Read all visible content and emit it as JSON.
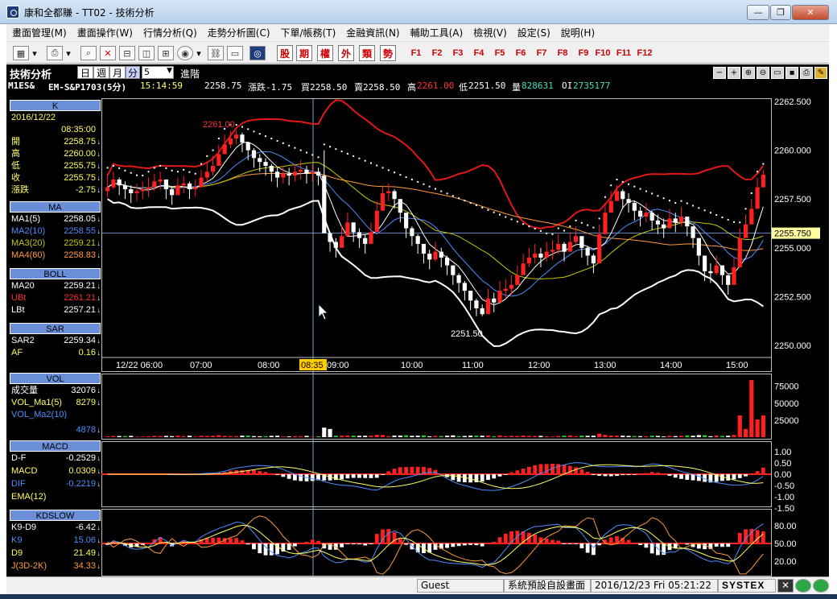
{
  "window": {
    "title": "康和全都賺 - TT02 - 技術分析",
    "btn_min": "—",
    "btn_max": "❐",
    "btn_close": "✕"
  },
  "menu": [
    "畫面管理(M)",
    "畫面操作(W)",
    "行情分析(Q)",
    "走勢分析圖(C)",
    "下單/帳務(T)",
    "金融資訊(N)",
    "輔助工具(A)",
    "檢視(V)",
    "設定(S)",
    "說明(H)"
  ],
  "toolbar": {
    "red_buttons": [
      "股",
      "期",
      "權",
      "外",
      "類",
      "勢"
    ],
    "function_keys": [
      "F1",
      "F2",
      "F3",
      "F4",
      "F5",
      "F6",
      "F7",
      "F8",
      "F9",
      "F10",
      "F11",
      "F12"
    ]
  },
  "analysis": {
    "title": "技術分析",
    "periods": [
      "日",
      "週",
      "月",
      "分"
    ],
    "period_value": "5",
    "advanced": "進階"
  },
  "quote": {
    "symbol": "M1ES&",
    "name": "EM-S&P1703(5分)",
    "time": "15:14:59",
    "last": "2258.75",
    "change": "漲跌-1.75",
    "bid": "買2258.50",
    "ask": "賣2258.50",
    "high_label": "高",
    "high": "2261.00",
    "low_label": "低",
    "low": "2251.50",
    "vol_label": "量",
    "vol": "828631",
    "oi_label": "OI",
    "oi": "2735177"
  },
  "left_panel": {
    "k_header": "K",
    "date": "2016/12/22",
    "time": "08:35:00",
    "ohlc": [
      {
        "k": "開",
        "v": "2258.75"
      },
      {
        "k": "高",
        "v": "2260.00"
      },
      {
        "k": "低",
        "v": "2255.75"
      },
      {
        "k": "收",
        "v": "2255.75"
      },
      {
        "k": "漲跌",
        "v": "-2.75"
      }
    ],
    "ma_header": "MA",
    "ma": [
      {
        "k": "MA1(5)",
        "v": "2258.05",
        "c": "#ffffff"
      },
      {
        "k": "MA2(10)",
        "v": "2258.55",
        "c": "#4f8cff"
      },
      {
        "k": "MA3(20)",
        "v": "2259.21",
        "c": "#c8c800"
      },
      {
        "k": "MA4(60)",
        "v": "2258.83",
        "c": "#ff9a3c"
      }
    ],
    "boll_header": "BOLL",
    "boll": [
      {
        "k": "MA20",
        "v": "2259.21",
        "c": "#ffffff"
      },
      {
        "k": "UBt",
        "v": "2261.21",
        "c": "#ff3030"
      },
      {
        "k": "LBt",
        "v": "2257.21",
        "c": "#ffffff"
      }
    ],
    "sar_header": "SAR",
    "sar": [
      {
        "k": "SAR2",
        "v": "2259.34",
        "c": "#ffffff"
      },
      {
        "k": "AF",
        "v": "0.16",
        "c": "#ffff60"
      }
    ],
    "vol_header": "VOL",
    "vol": [
      {
        "k": "成交量",
        "v": "32076",
        "c": "#ffffff"
      },
      {
        "k": "VOL_Ma1(5)",
        "v": "8279",
        "c": "#ffff60"
      },
      {
        "k": "VOL_Ma2(10)",
        "v": "",
        "c": "#4f8cff"
      },
      {
        "k": "",
        "v": "4878",
        "c": "#4f8cff"
      }
    ],
    "macd_header": "MACD",
    "macd": [
      {
        "k": "D-F",
        "v": "-0.2529",
        "c": "#ffffff"
      },
      {
        "k": "MACD",
        "v": "0.0309",
        "c": "#ffff60"
      },
      {
        "k": "DIF",
        "v": "-0.2219",
        "c": "#4f8cff"
      },
      {
        "k": "EMA(12)",
        "v": "",
        "c": "#ffff60"
      }
    ],
    "kd_header": "KDSLOW",
    "kd": [
      {
        "k": "K9-D9",
        "v": "-6.42",
        "c": "#ffffff"
      },
      {
        "k": "K9",
        "v": "15.06",
        "c": "#4f8cff"
      },
      {
        "k": "D9",
        "v": "21.49",
        "c": "#ffff60"
      },
      {
        "k": "J(3D-2K)",
        "v": "34.33",
        "c": "#ff9a3c"
      }
    ]
  },
  "chart_data": {
    "type": "candlestick",
    "price_axis": {
      "ticks": [
        "2262.500",
        "2260.000",
        "2257.500",
        "2255.000",
        "2252.500",
        "2250.000"
      ],
      "current": "2255.750"
    },
    "time_axis": {
      "labels": [
        "12/22 06:00",
        "07:00",
        "08:00",
        "09:00",
        "10:00",
        "11:00",
        "12:00",
        "13:00",
        "14:00",
        "15:00"
      ],
      "cursor": "08:35"
    },
    "annotations": {
      "high": "2261.00",
      "low": "2251.50"
    },
    "vol_axis": [
      "75000",
      "50000",
      "25000"
    ],
    "macd_axis": [
      "1.00",
      "0.50",
      "0.00",
      "-0.50",
      "-1.00",
      "-1.50"
    ],
    "kd_axis": [
      "80.00",
      "50.00",
      "20.00"
    ],
    "close": [
      2258.1,
      2258.5,
      2258.2,
      2258.0,
      2257.8,
      2257.9,
      2258.0,
      2258.1,
      2258.4,
      2258.5,
      2258.0,
      2257.7,
      2258.2,
      2258.3,
      2258.0,
      2258.1,
      2258.6,
      2258.9,
      2259.2,
      2259.8,
      2260.3,
      2260.6,
      2260.8,
      2260.4,
      2260.0,
      2259.6,
      2259.4,
      2259.2,
      2258.9,
      2258.6,
      2258.8,
      2258.7,
      2258.9,
      2259.0,
      2258.8,
      2258.9,
      2258.7,
      2255.75,
      2255.3,
      2255.0,
      2255.6,
      2256.3,
      2255.8,
      2255.5,
      2255.2,
      2255.8,
      2256.9,
      2257.8,
      2257.9,
      2257.5,
      2256.8,
      2256.0,
      2255.6,
      2255.2,
      2254.7,
      2254.4,
      2254.8,
      2254.5,
      2254.1,
      2253.6,
      2253.2,
      2252.8,
      2252.3,
      2251.9,
      2251.6,
      2252.4,
      2252.2,
      2252.8,
      2252.9,
      2253.1,
      2253.6,
      2254.2,
      2254.5,
      2254.7,
      2254.5,
      2254.8,
      2254.9,
      2255.2,
      2254.8,
      2255.3,
      2255.6,
      2255.0,
      2254.6,
      2254.2,
      2255.7,
      2256.8,
      2257.4,
      2257.9,
      2257.5,
      2257.3,
      2256.9,
      2256.6,
      2256.8,
      2256.4,
      2256.2,
      2256.0,
      2256.5,
      2256.3,
      2256.6,
      2256.1,
      2255.5,
      2254.6,
      2253.8,
      2253.7,
      2254.1,
      2253.6,
      2253.1,
      2254.0,
      2255.5,
      2256.2,
      2257.0,
      2258.1,
      2258.75
    ],
    "high": [
      2258.8,
      2258.9,
      2258.6,
      2258.4,
      2258.2,
      2258.3,
      2258.4,
      2258.6,
      2258.8,
      2258.9,
      2258.5,
      2258.1,
      2258.6,
      2258.7,
      2258.4,
      2258.5,
      2259.0,
      2259.4,
      2259.7,
      2260.3,
      2260.8,
      2261.0,
      2261.0,
      2260.9,
      2260.4,
      2260.1,
      2259.8,
      2259.6,
      2259.3,
      2259.1,
      2259.2,
      2259.1,
      2259.3,
      2259.5,
      2259.2,
      2259.3,
      2259.1,
      2260.0,
      2255.8,
      2255.5,
      2256.1,
      2256.8,
      2256.3,
      2256.0,
      2255.7,
      2256.3,
      2257.4,
      2258.2,
      2258.3,
      2258.0,
      2257.3,
      2256.5,
      2256.1,
      2255.7,
      2255.2,
      2254.9,
      2255.3,
      2255.0,
      2254.6,
      2254.1,
      2253.7,
      2253.3,
      2252.8,
      2252.4,
      2252.1,
      2252.9,
      2252.7,
      2253.3,
      2253.4,
      2253.6,
      2254.1,
      2254.7,
      2255.0,
      2255.2,
      2255.0,
      2255.3,
      2255.4,
      2255.7,
      2255.3,
      2255.8,
      2256.1,
      2255.5,
      2255.1,
      2254.7,
      2256.2,
      2257.3,
      2257.9,
      2258.2,
      2258.0,
      2257.8,
      2257.4,
      2257.1,
      2257.3,
      2256.9,
      2256.7,
      2256.5,
      2257.0,
      2256.8,
      2257.1,
      2256.6,
      2256.0,
      2255.1,
      2254.3,
      2254.2,
      2254.6,
      2254.1,
      2253.6,
      2254.5,
      2256.0,
      2256.7,
      2257.5,
      2258.6,
      2259.0
    ],
    "low": [
      2257.6,
      2258.0,
      2257.7,
      2257.5,
      2257.3,
      2257.4,
      2257.5,
      2257.6,
      2257.9,
      2258.0,
      2257.5,
      2257.2,
      2257.7,
      2257.8,
      2257.5,
      2257.6,
      2258.1,
      2258.4,
      2258.7,
      2259.3,
      2259.8,
      2260.1,
      2260.3,
      2259.9,
      2259.5,
      2259.1,
      2258.9,
      2258.7,
      2258.4,
      2258.1,
      2258.3,
      2258.2,
      2258.4,
      2258.5,
      2258.3,
      2258.4,
      2258.2,
      2255.75,
      2254.8,
      2254.5,
      2255.1,
      2255.8,
      2255.3,
      2255.0,
      2254.7,
      2255.3,
      2256.4,
      2257.3,
      2257.4,
      2257.0,
      2256.3,
      2255.5,
      2255.1,
      2254.7,
      2254.2,
      2253.9,
      2254.3,
      2254.0,
      2253.6,
      2253.1,
      2252.7,
      2252.3,
      2251.8,
      2251.5,
      2251.5,
      2251.9,
      2251.7,
      2252.3,
      2252.4,
      2252.6,
      2253.1,
      2253.7,
      2254.0,
      2254.2,
      2254.0,
      2254.3,
      2254.4,
      2254.7,
      2254.3,
      2254.8,
      2255.1,
      2254.5,
      2254.1,
      2253.7,
      2255.2,
      2256.3,
      2256.9,
      2257.4,
      2257.0,
      2256.8,
      2256.4,
      2256.1,
      2256.3,
      2255.9,
      2255.7,
      2255.5,
      2256.0,
      2255.8,
      2256.1,
      2255.6,
      2255.0,
      2254.1,
      2253.3,
      2253.2,
      2253.6,
      2253.1,
      2252.6,
      2253.5,
      2255.0,
      2255.7,
      2256.5,
      2257.6,
      2258.2
    ]
  },
  "status": {
    "user": "Guest",
    "screen": "系統預設自設畫面",
    "datetime": "2016/12/23 Fri 05:21:22",
    "brand": "SYSTEX"
  }
}
